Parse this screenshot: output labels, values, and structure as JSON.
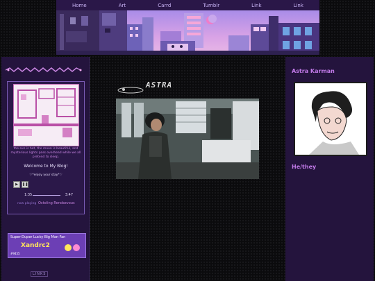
{
  "nav": {
    "items": [
      "Home",
      "Art",
      "Carrd",
      "Tumblr",
      "Link",
      "Link"
    ]
  },
  "player": {
    "description": "the sun is hot, the moon is beautiful, and mysterious lights pass overhead while we all pretend to sleep.",
    "welcome": "Welcome to My Blog!",
    "enjoy": "♡*enjoy your stay*♡",
    "time_current": "1:35",
    "time_total": "3:47",
    "now_playing_label": "now playing",
    "song": "Octoling Rendezvous"
  },
  "badge": {
    "top": "Super-Duper Lucky Big Man Fan",
    "name": "Xandrc2",
    "number": "#9455"
  },
  "links_label": "LINKS",
  "center": {
    "logo_text": "ASTRA"
  },
  "profile": {
    "name": "Astra Karman",
    "pronouns": "He/they"
  },
  "colors": {
    "accent": "#c17ae8",
    "panel": "#24143d",
    "nav": "#2a1748"
  }
}
